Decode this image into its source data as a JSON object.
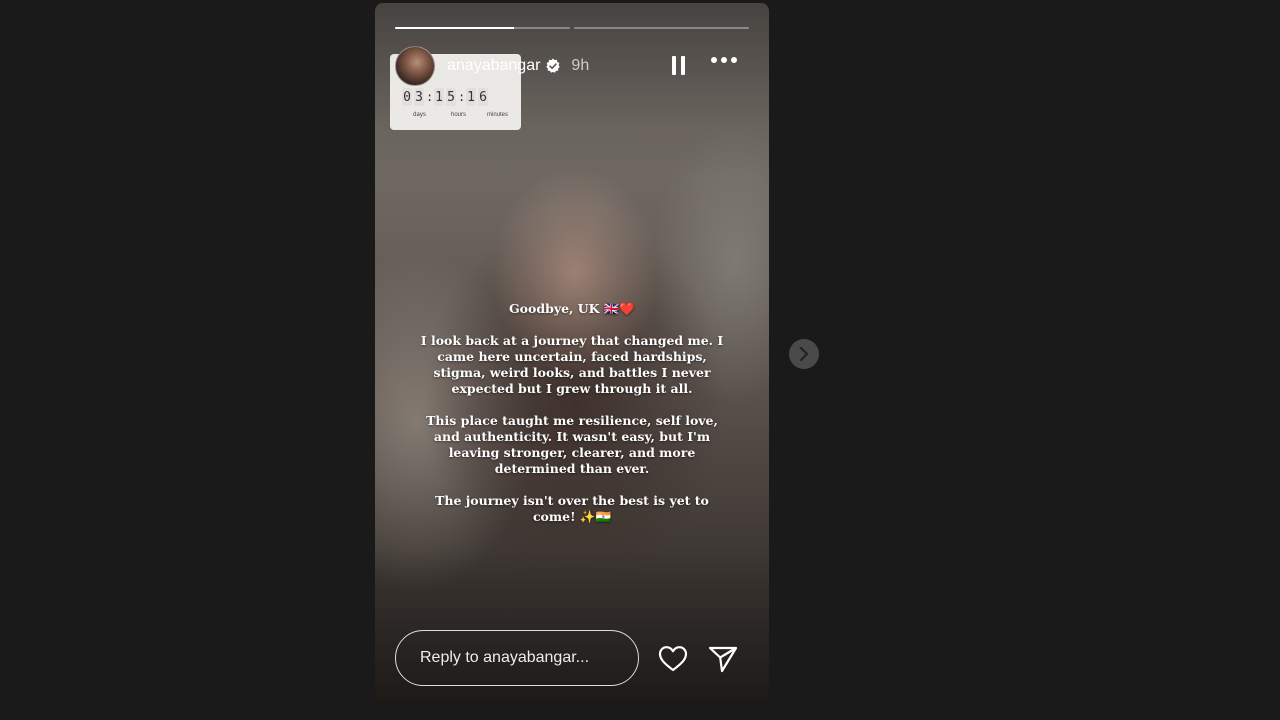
{
  "story": {
    "username": "anayabangar",
    "verified": true,
    "time_ago": "9h",
    "progress": [
      1.0,
      0.0
    ],
    "active_segment_progress": 0.68
  },
  "countdown": {
    "digits": [
      "0",
      "3",
      "1",
      "5",
      "1",
      "6"
    ],
    "units": [
      "days",
      "hours",
      "minutes"
    ]
  },
  "caption": {
    "p1": "Goodbye, UK 🇬🇧❤️",
    "p2": "I look back at a journey that changed me. I came here uncertain, faced hardships, stigma, weird looks, and battles I never expected but I grew through it all.",
    "p3": "This place taught me resilience, self love, and authenticity. It wasn't easy, but I'm leaving stronger, clearer, and more determined than ever.",
    "p4": "The journey isn't over the best is yet to come! ✨🇮🇳"
  },
  "reply": {
    "placeholder": "Reply to anayabangar..."
  },
  "icons": {
    "verified": "verified-badge-icon",
    "pause": "pause-icon",
    "more": "more-options-icon",
    "heart": "heart-icon",
    "send": "send-icon",
    "next": "chevron-right-icon"
  }
}
